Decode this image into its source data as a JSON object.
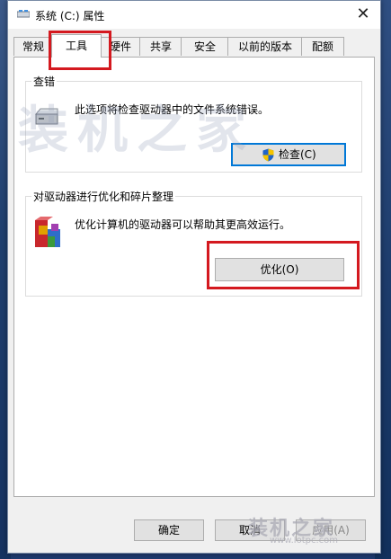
{
  "window": {
    "title": "系统 (C:) 属性",
    "close_glyph": "✕"
  },
  "tabs": [
    {
      "label": "常规"
    },
    {
      "label": "工具"
    },
    {
      "label": "硬件"
    },
    {
      "label": "共享"
    },
    {
      "label": "安全"
    },
    {
      "label": "以前的版本"
    },
    {
      "label": "配额"
    }
  ],
  "check_group": {
    "title": "查错",
    "description": "此选项将检查驱动器中的文件系统错误。",
    "button_label": "检查(C)"
  },
  "optimize_group": {
    "title": "对驱动器进行优化和碎片整理",
    "description": "优化计算机的驱动器可以帮助其更高效运行。",
    "button_label": "优化(O)"
  },
  "footer": {
    "ok_label": "确定",
    "cancel_label": "取消",
    "apply_label": "应用(A)"
  },
  "watermark": {
    "text": "装机之家",
    "bottom_text": "装机之家",
    "bottom_url": "www.lotpc.com"
  },
  "colors": {
    "highlight": "#d4191f",
    "accent": "#0078d7"
  }
}
